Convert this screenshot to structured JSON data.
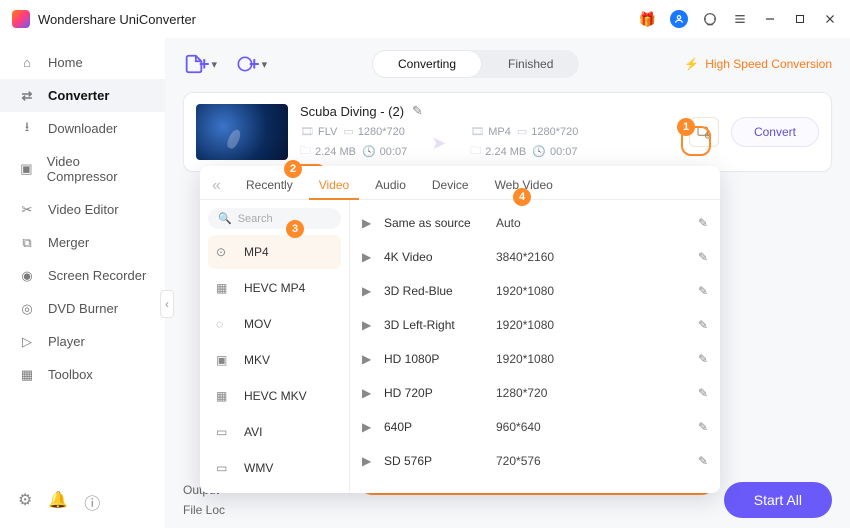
{
  "app": {
    "title": "Wondershare UniConverter"
  },
  "sidebar": {
    "items": [
      {
        "label": "Home"
      },
      {
        "label": "Converter"
      },
      {
        "label": "Downloader"
      },
      {
        "label": "Video Compressor"
      },
      {
        "label": "Video Editor"
      },
      {
        "label": "Merger"
      },
      {
        "label": "Screen Recorder"
      },
      {
        "label": "DVD Burner"
      },
      {
        "label": "Player"
      },
      {
        "label": "Toolbox"
      }
    ]
  },
  "segmented": {
    "converting": "Converting",
    "finished": "Finished"
  },
  "hsc": "High Speed Conversion",
  "file": {
    "name": "Scuba Diving - (2)",
    "src": {
      "format": "FLV",
      "resolution": "1280*720",
      "size": "2.24 MB",
      "duration": "00:07"
    },
    "dst": {
      "format": "MP4",
      "resolution": "1280*720",
      "size": "2.24 MB",
      "duration": "00:07"
    },
    "convert": "Convert"
  },
  "popover": {
    "search_placeholder": "Search",
    "tabs": [
      "Recently",
      "Video",
      "Audio",
      "Device",
      "Web Video"
    ],
    "formats": [
      "MP4",
      "HEVC MP4",
      "MOV",
      "MKV",
      "HEVC MKV",
      "AVI",
      "WMV"
    ],
    "presets": [
      {
        "name": "Same as source",
        "res": "Auto"
      },
      {
        "name": "4K Video",
        "res": "3840*2160"
      },
      {
        "name": "3D Red-Blue",
        "res": "1920*1080"
      },
      {
        "name": "3D Left-Right",
        "res": "1920*1080"
      },
      {
        "name": "HD 1080P",
        "res": "1920*1080"
      },
      {
        "name": "HD 720P",
        "res": "1280*720"
      },
      {
        "name": "640P",
        "res": "960*640"
      },
      {
        "name": "SD 576P",
        "res": "720*576"
      }
    ]
  },
  "callouts": [
    "1",
    "2",
    "3",
    "4"
  ],
  "bottom": {
    "output": "Output",
    "fileloc": "File Loc",
    "start_all": "Start All"
  }
}
